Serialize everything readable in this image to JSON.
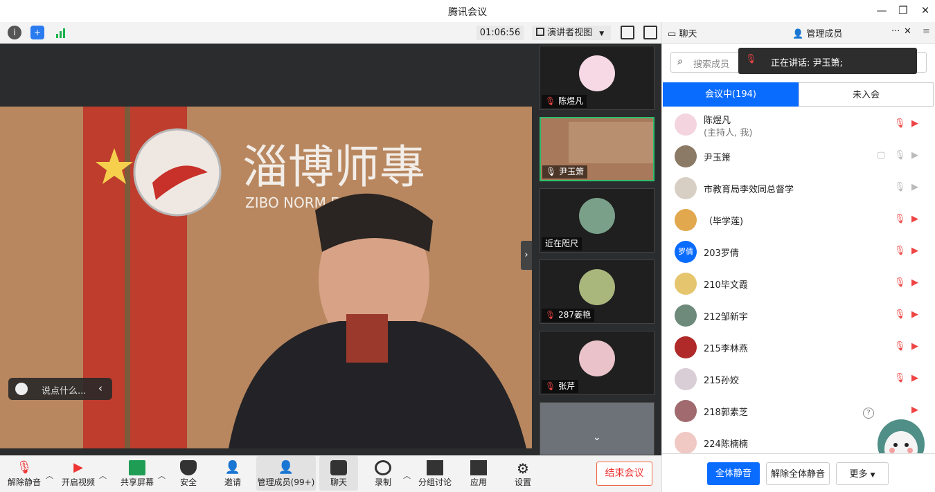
{
  "window": {
    "title": "腾讯会议"
  },
  "topbar": {
    "timer": "01:06:56",
    "view_label": "演讲者视图"
  },
  "main": {
    "chat_placeholder": "说点什么..."
  },
  "sidestrip": {
    "tiles": [
      {
        "name": "陈煜凡"
      },
      {
        "name": "尹玉箫"
      },
      {
        "name": "近在咫尺"
      },
      {
        "name": "287姜艳"
      },
      {
        "name": "张芹"
      }
    ]
  },
  "panel": {
    "tabs": {
      "chat": "聊天",
      "members": "管理成员"
    },
    "search_placeholder": "搜索成员",
    "speaking": "正在讲话: 尹玉箫;",
    "segments": {
      "in_meeting": "会议中(194)",
      "not_joined": "未入会"
    },
    "members": [
      {
        "name": "陈煜凡",
        "sub": "(主持人, 我)"
      },
      {
        "name": "尹玉箫"
      },
      {
        "name": "市教育局李效同总督学"
      },
      {
        "name": "（毕学莲)"
      },
      {
        "name": "203罗倩",
        "avatar_text": "罗倩"
      },
      {
        "name": "210毕文霞"
      },
      {
        "name": "212邹新宇"
      },
      {
        "name": "215李林燕"
      },
      {
        "name": "215孙姣"
      },
      {
        "name": "218郭素芝"
      },
      {
        "name": "224陈楠楠"
      }
    ],
    "footer": {
      "mute_all": "全体静音",
      "unmute_all": "解除全体静音",
      "more": "更多"
    }
  },
  "toolbar": {
    "unmute": "解除静音",
    "video": "开启视频",
    "share": "共享屏幕",
    "security": "安全",
    "invite": "邀请",
    "members": "管理成员(99+)",
    "chat": "聊天",
    "record": "录制",
    "breakout": "分组讨论",
    "apps": "应用",
    "settings": "设置",
    "end": "结束会议"
  },
  "colors": {
    "accent": "#0a6cff",
    "end": "#e33"
  }
}
